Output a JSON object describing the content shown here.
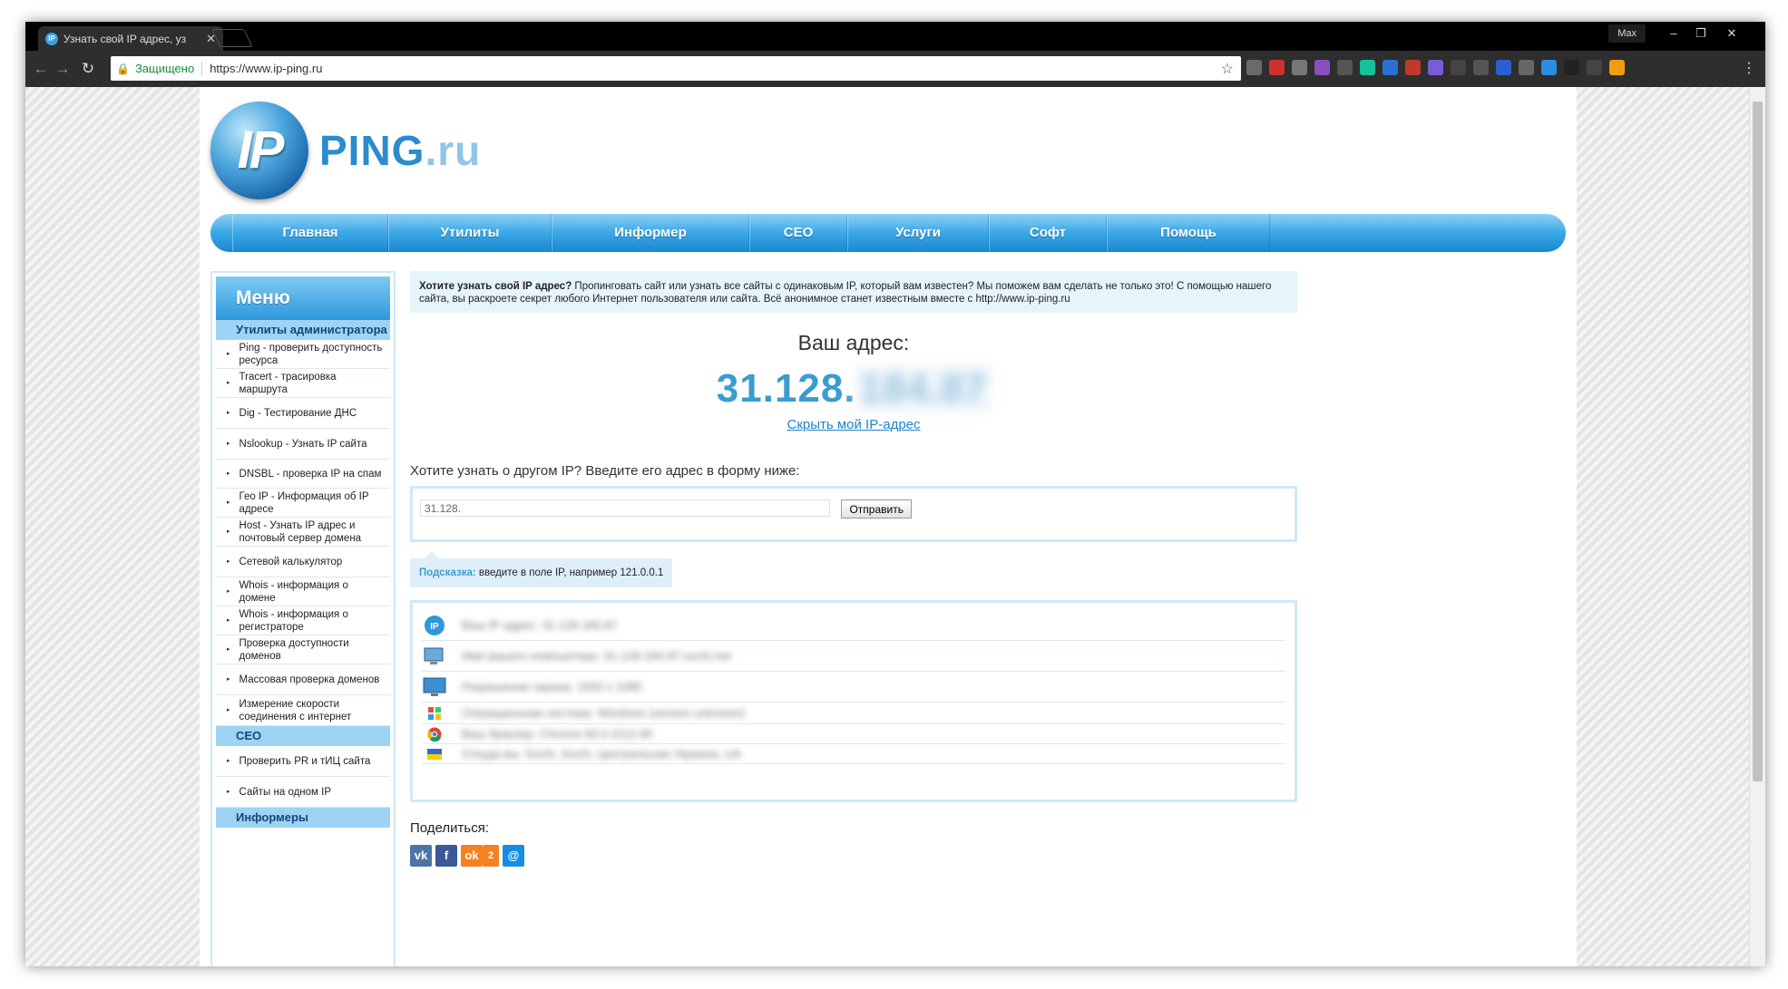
{
  "browser": {
    "tab_title": "Узнать свой IP адрес, уз",
    "tab_favicon": "IP",
    "tab_close": "✕",
    "user_label": "Max",
    "security_label": "Защищено",
    "url": "https://www.ip-ping.ru",
    "extensions": [
      "pocket-icon",
      "ext-red-icon",
      "paw-icon",
      "bug-icon",
      "off-icon",
      "grammarly-icon",
      "new-icon",
      "badge-6-icon",
      "w-icon",
      "cloud-icon",
      "window-icon",
      "shield-icon",
      "globe-icon",
      "circle-blue-icon",
      "dark-circle-icon",
      "reader-icon",
      "rss-icon"
    ]
  },
  "logo": {
    "initials": "IP",
    "brand": "PING",
    "tld": ".ru"
  },
  "nav": [
    "Главная",
    "Утилиты",
    "Информер",
    "СЕО",
    "Услуги",
    "Софт",
    "Помощь"
  ],
  "sidebar": {
    "title": "Меню",
    "sections": [
      {
        "title": "Утилиты администратора",
        "items": [
          "Ping - проверить доступность ресурса",
          "Tracert - трасировка маршрута",
          "Dig - Тестирование ДНС",
          "Nslookup - Узнать IP сайта",
          "DNSBL - проверка IP на спам",
          "Гео IP - Информация об IP адресе",
          "Host - Узнать IP адрес и почтовый сервер домена",
          "Сетевой калькулятор",
          "Whois - информация о домене",
          "Whois - информация о регистраторе",
          "Проверка доступности доменов",
          "Массовая проверка доменов",
          "Измерение скорости соединения с интернет"
        ]
      },
      {
        "title": "СЕО",
        "items": [
          "Проверить PR и тИЦ сайта",
          "Сайты на одном IP"
        ]
      },
      {
        "title": "Информеры",
        "items": []
      }
    ]
  },
  "main": {
    "intro_bold": "Хотите узнать свой IP адрес?",
    "intro_text": " Пропинговать сайт или узнать все сайты с одинаковым IP, который вам известен? Мы поможем вам сделать не только это! С помощью нашего сайта, вы раскроете секрет любого Интернет пользователя или сайта. Всё анонимное станет известным вместе с http://www.ip-ping.ru",
    "address_label": "Ваш адрес:",
    "ip_visible": "31.128.",
    "ip_hidden": "184.87",
    "hide_link": "Скрыть мой IP-адрес",
    "other_prompt": "Хотите узнать о другом IP? Введите его адрес в форму ниже:",
    "ip_input_value": "31.128.",
    "send_button": "Отправить",
    "hint_label": "Подсказка:",
    "hint_text": " введите в поле IP, например 121.0.0.1",
    "info_rows": [
      {
        "icon": "ip-icon",
        "text": "Ваш IP адрес: 31.128.184.87"
      },
      {
        "icon": "computer-icon",
        "text": "Имя вашего компьютера: 31-128-184-87.sochi.net"
      },
      {
        "icon": "monitor-icon",
        "text": "Разрешение экрана: 1920 x 1080"
      },
      {
        "icon": "windows-icon",
        "text": "Операционная система: Windows (version unknown)"
      },
      {
        "icon": "chrome-icon",
        "text": "Ваш браузер: Chrome 60.0.3112.90"
      },
      {
        "icon": "flag-icon",
        "text": "Откуда вы: Sochi, Sochi, Центральная Украина, UA"
      }
    ],
    "share_label": "Поделиться:",
    "share_icons": [
      {
        "name": "vk-share-icon",
        "label": "vk",
        "color": "#4c75a3"
      },
      {
        "name": "facebook-share-icon",
        "label": "f",
        "color": "#3b5998"
      },
      {
        "name": "odnoklassniki-share-icon",
        "label": "ok",
        "color": "#f58220"
      },
      {
        "name": "odnoklassniki-count",
        "label": "2",
        "color": "#f58220"
      },
      {
        "name": "mymail-share-icon",
        "label": "@",
        "color": "#168de2"
      }
    ]
  }
}
